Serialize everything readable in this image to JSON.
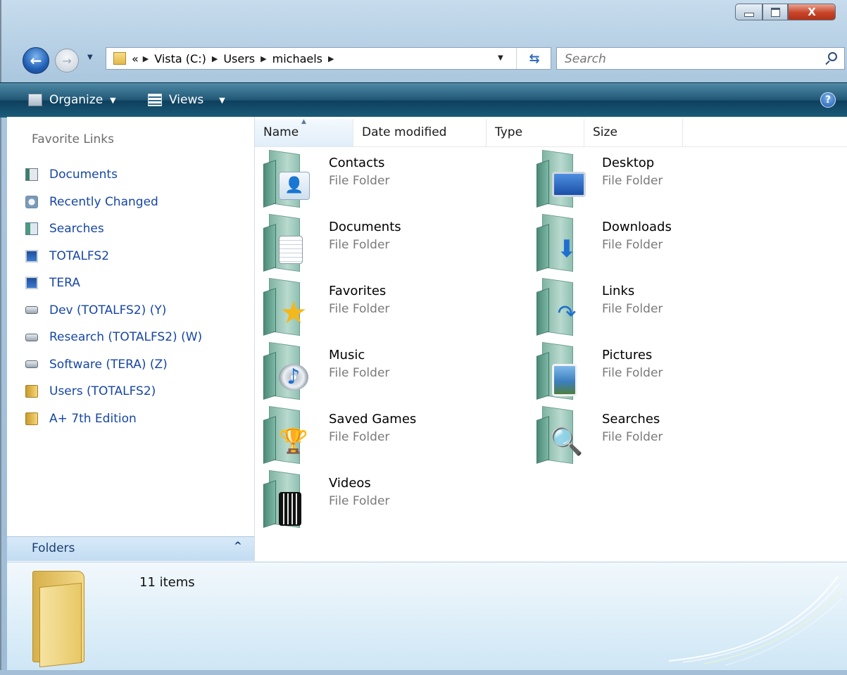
{
  "window": {
    "close_glyph": "X"
  },
  "nav": {
    "back_glyph": "←",
    "forward_glyph": "→",
    "address_chevron": "«",
    "breadcrumbs": [
      "Vista (C:)",
      "Users",
      "michaels"
    ],
    "search_placeholder": "Search"
  },
  "toolbar": {
    "organize_label": "Organize",
    "views_label": "Views",
    "help_glyph": "?"
  },
  "sidebar": {
    "title": "Favorite Links",
    "items": [
      {
        "label": "Documents",
        "icon": "documents-icon"
      },
      {
        "label": "Recently Changed",
        "icon": "recently-changed-icon"
      },
      {
        "label": "Searches",
        "icon": "searches-icon"
      },
      {
        "label": "TOTALFS2",
        "icon": "computer-icon"
      },
      {
        "label": "TERA",
        "icon": "computer-icon"
      },
      {
        "label": "Dev (TOTALFS2) (Y)",
        "icon": "network-drive-icon"
      },
      {
        "label": "Research (TOTALFS2) (W)",
        "icon": "network-drive-icon"
      },
      {
        "label": "Software (TERA) (Z)",
        "icon": "network-drive-icon"
      },
      {
        "label": "Users (TOTALFS2)",
        "icon": "folder-icon"
      },
      {
        "label": "A+ 7th Edition",
        "icon": "folder-icon"
      }
    ],
    "folders_label": "Folders",
    "folders_toggle": "^"
  },
  "columns": [
    "Name",
    "Date modified",
    "Type",
    "Size"
  ],
  "files": [
    {
      "name": "Contacts",
      "type": "File Folder",
      "icon": "contacts-folder-icon"
    },
    {
      "name": "Desktop",
      "type": "File Folder",
      "icon": "desktop-folder-icon"
    },
    {
      "name": "Documents",
      "type": "File Folder",
      "icon": "documents-folder-icon"
    },
    {
      "name": "Downloads",
      "type": "File Folder",
      "icon": "downloads-folder-icon"
    },
    {
      "name": "Favorites",
      "type": "File Folder",
      "icon": "favorites-folder-icon"
    },
    {
      "name": "Links",
      "type": "File Folder",
      "icon": "links-folder-icon"
    },
    {
      "name": "Music",
      "type": "File Folder",
      "icon": "music-folder-icon"
    },
    {
      "name": "Pictures",
      "type": "File Folder",
      "icon": "pictures-folder-icon"
    },
    {
      "name": "Saved Games",
      "type": "File Folder",
      "icon": "saved-games-folder-icon"
    },
    {
      "name": "Searches",
      "type": "File Folder",
      "icon": "searches-folder-icon"
    },
    {
      "name": "Videos",
      "type": "File Folder",
      "icon": "videos-folder-icon"
    }
  ],
  "details": {
    "item_count": "11 items"
  },
  "colors": {
    "command_bar": "#1f5674",
    "link": "#1646a6",
    "folder_teal": "#7fb3a2"
  }
}
